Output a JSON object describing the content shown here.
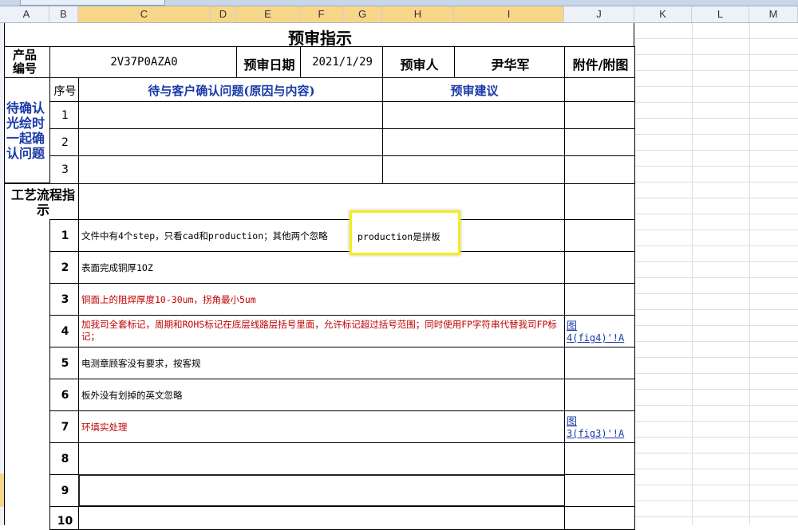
{
  "columns": [
    "A",
    "B",
    "C",
    "D",
    "E",
    "F",
    "G",
    "H",
    "I",
    "J",
    "K",
    "L",
    "M"
  ],
  "sheet": {
    "title": "预审指示",
    "product_no_label": "产品编号",
    "product_no": "2V37P0AZA0",
    "review_date_label": "预审日期",
    "review_date": "2021/1/29",
    "reviewer_label": "预审人",
    "reviewer": "尹华军",
    "attachment_label": "附件/附图",
    "seq_label": "序号",
    "issues_header": "待与客户确认问题(原因与内容)",
    "suggest_header": "预审建议",
    "left_section_label": "待确认光绘时一起确认问题",
    "issue_rows": [
      "1",
      "2",
      "3"
    ],
    "process_label": "工艺流程指示",
    "process_rows": [
      {
        "no": "1",
        "text": "文件中有4个step，只看cad和production；其他两个忽略",
        "attach": ""
      },
      {
        "no": "2",
        "text": "表面完成铜厚1OZ",
        "attach": ""
      },
      {
        "no": "3",
        "text": "铜面上的阻焊厚度10-30um，拐角最小5um",
        "attach": ""
      },
      {
        "no": "4",
        "text": "加我司全套标记，周期和ROHS标记在底层线路层括号里面，允许标记超过括号范围；同时使用FP字符串代替我司FP标记；",
        "attach": "图4(fig4)'!A"
      },
      {
        "no": "5",
        "text": "电测章顾客没有要求，按客规",
        "attach": ""
      },
      {
        "no": "6",
        "text": "板外没有划掉的英文忽略",
        "attach": ""
      },
      {
        "no": "7",
        "text": "环填实处理",
        "attach": "图3(fig3)'!A"
      },
      {
        "no": "8",
        "text": "",
        "attach": ""
      },
      {
        "no": "9",
        "text": "",
        "attach": ""
      },
      {
        "no": "10",
        "text": "",
        "attach": ""
      }
    ],
    "note_box": "production是拼板",
    "attach4_line1": "图",
    "attach4_line2": "4(fig4)'!A",
    "attach7_line1": "图",
    "attach7_line2": "3(fig3)'!A"
  }
}
